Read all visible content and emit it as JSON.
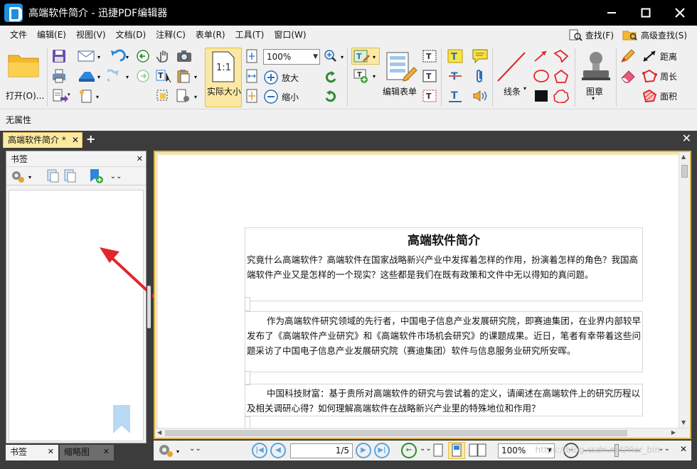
{
  "window": {
    "title": "高端软件简介 - 迅捷PDF编辑器"
  },
  "menu": {
    "items": [
      "文件",
      "编辑(E)",
      "视图(V)",
      "文档(D)",
      "注释(C)",
      "表单(R)",
      "工具(T)",
      "窗口(W)"
    ],
    "find_label": "查找(F)",
    "advanced_find_label": "高级查找(S)"
  },
  "ribbon": {
    "open_label": "打开(O)...",
    "zoom_value": "100%",
    "actual_size_label": "实际大小",
    "zoom_in_label": "放大",
    "zoom_out_label": "缩小",
    "edit_form_label": "编辑表单",
    "line_label": "线条",
    "stamp_label": "图章",
    "distance_label": "距离",
    "perimeter_label": "周长",
    "area_label": "面积"
  },
  "properties": {
    "label": "无属性"
  },
  "tabs": {
    "doc_tab_label": "高端软件简介 *"
  },
  "bookmark_panel": {
    "title": "书签",
    "bottom_tab_bookmarks": "书签",
    "bottom_tab_thumbnails": "缩略图"
  },
  "document": {
    "title": "高端软件简介",
    "para1": "究竟什么高端软件？高端软件在国家战略新兴产业中发挥着怎样的作用，扮演着怎样的角色？我国高端软件产业又是怎样的一个现实？这些都是我们在既有政策和文件中无以得知的真问题。",
    "para2": "作为高端软件研究领域的先行者，中国电子信息产业发展研究院，即赛迪集团，在业界内部较早发布了《高端软件产业研究》和《高端软件市场机会研究》的课题成果。近日，笔者有幸带着这些问题采访了中国电子信息产业发展研究院（赛迪集团）软件与信息服务业研究所安晖。",
    "para3": "中国科技财富：基于贵所对高端软件的研究与尝试着的定义，请阐述在高端软件上的研究历程以及相关调研心得？如何理解高端软件在战略新兴产业里的特殊地位和作用？"
  },
  "statusbar": {
    "page_value": "1/5",
    "zoom_value": "100%",
    "watermark": "https://blog.csdn.net/Yier_bin"
  },
  "colors": {
    "accent_yellow": "#fbe9a3",
    "blue_icon": "#2e86de",
    "red_icon": "#e0262b"
  }
}
